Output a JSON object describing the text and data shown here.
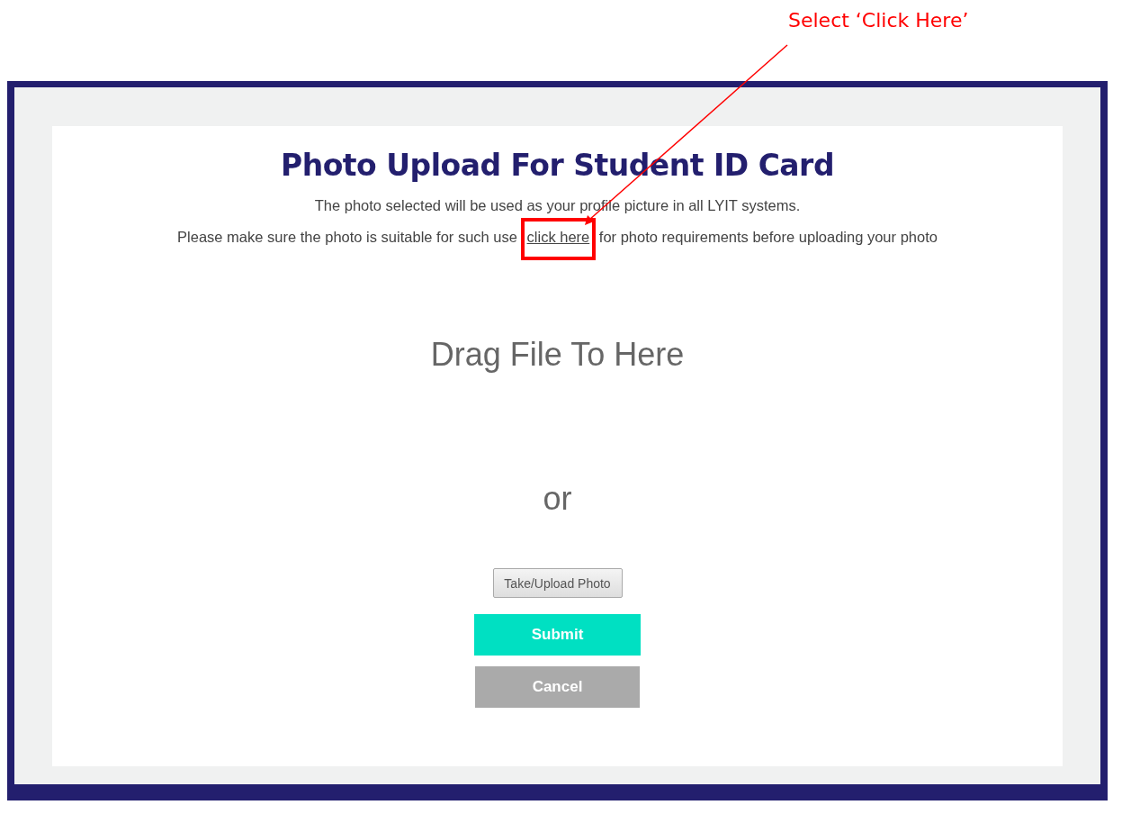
{
  "annotation": {
    "label": "Select ‘Click Here’"
  },
  "title": "Photo Upload For Student ID Card",
  "intro": "The photo selected will be used as your profile picture in all LYIT systems.",
  "notice": {
    "before": "Please make sure the photo is suitable for such use",
    "link": "click here",
    "after": "for photo requirements before uploading your photo"
  },
  "drop_zone": {
    "label": "Drag File To Here"
  },
  "separator": "or",
  "buttons": [
    {
      "label": "Take/Upload Photo",
      "kind": "file"
    },
    {
      "label": "Submit",
      "kind": "primary"
    },
    {
      "label": "Cancel",
      "kind": "secondary"
    }
  ]
}
